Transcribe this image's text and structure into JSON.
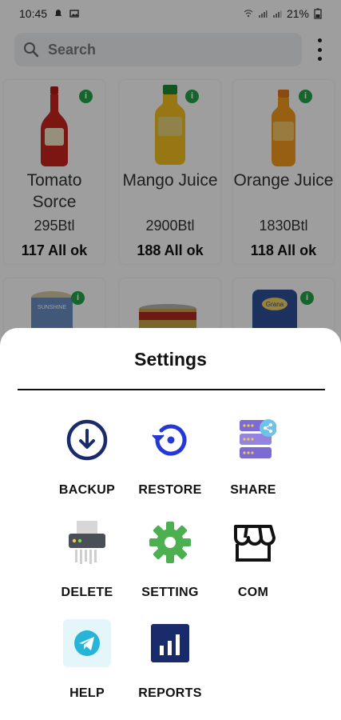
{
  "status_bar": {
    "time": "10:45",
    "battery": "21%"
  },
  "search": {
    "placeholder": "Search"
  },
  "products": [
    {
      "name": "Tomato Sorce",
      "quantity": "295Btl",
      "status": "117 All ok",
      "bottle_color": "#c8241f",
      "cap_color": "#b01c16"
    },
    {
      "name": "Mango Juice",
      "quantity": "2900Btl",
      "status": "188 All ok",
      "bottle_color": "#f3c01f",
      "cap_color": "#1f8a34"
    },
    {
      "name": "Orange Juice",
      "quantity": "1830Btl",
      "status": "118 All ok",
      "bottle_color": "#f29a1d",
      "cap_color": "#e2761a"
    }
  ],
  "partial_products": [
    {
      "brand": "SUNSHINE",
      "color": "#6a8fc4"
    },
    {
      "brand": "",
      "color": "#b5b5b5"
    },
    {
      "brand": "Grana",
      "color": "#2f4f98"
    }
  ],
  "settings_sheet": {
    "title": "Settings",
    "options": [
      {
        "label": "BACKUP",
        "icon": "download-circle-icon"
      },
      {
        "label": "RESTORE",
        "icon": "restore-icon"
      },
      {
        "label": "SHARE",
        "icon": "share-server-icon"
      },
      {
        "label": "DELETE",
        "icon": "shredder-icon"
      },
      {
        "label": "SETTING",
        "icon": "gear-icon"
      },
      {
        "label": "COM",
        "icon": "store-icon"
      },
      {
        "label": "HELP",
        "icon": "telegram-icon"
      },
      {
        "label": "REPORTS",
        "icon": "bar-chart-icon"
      }
    ]
  },
  "colors": {
    "accent_navy": "#1a2b6b",
    "accent_blue": "#2438d6",
    "gear_green": "#4caf50",
    "info_green": "#22a34a",
    "help_cyan": "#26b5d6"
  }
}
